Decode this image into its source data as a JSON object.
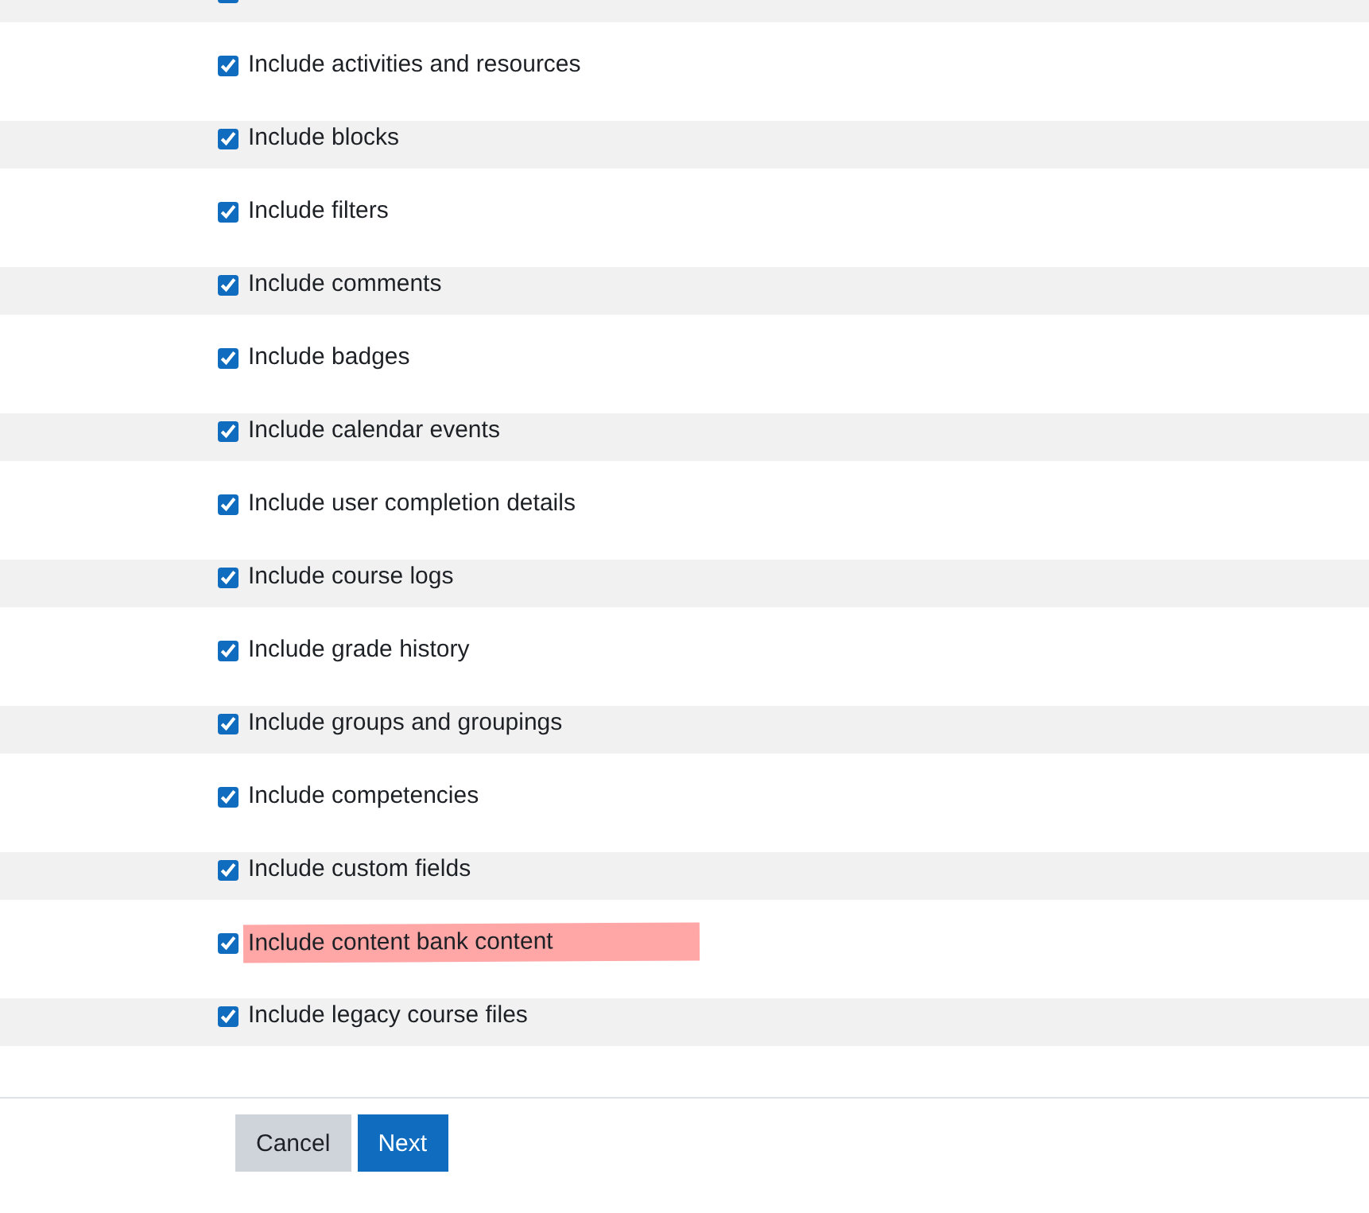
{
  "options": [
    {
      "checked": true
    },
    {
      "label": "Include activities and resources",
      "checked": true
    },
    {
      "label": "Include blocks",
      "checked": true
    },
    {
      "label": "Include filters",
      "checked": true
    },
    {
      "label": "Include comments",
      "checked": true
    },
    {
      "label": "Include badges",
      "checked": true
    },
    {
      "label": "Include calendar events",
      "checked": true
    },
    {
      "label": "Include user completion details",
      "checked": true
    },
    {
      "label": "Include course logs",
      "checked": true
    },
    {
      "label": "Include grade history",
      "checked": true
    },
    {
      "label": "Include groups and groupings",
      "checked": true
    },
    {
      "label": "Include competencies",
      "checked": true
    },
    {
      "label": "Include custom fields",
      "checked": true
    },
    {
      "label": "Include content bank content",
      "checked": true,
      "highlighted": true
    },
    {
      "label": "Include legacy course files",
      "checked": true
    }
  ],
  "buttons": [
    {
      "label": "Cancel",
      "kind": "secondary"
    },
    {
      "label": "Next",
      "kind": "primary"
    }
  ]
}
